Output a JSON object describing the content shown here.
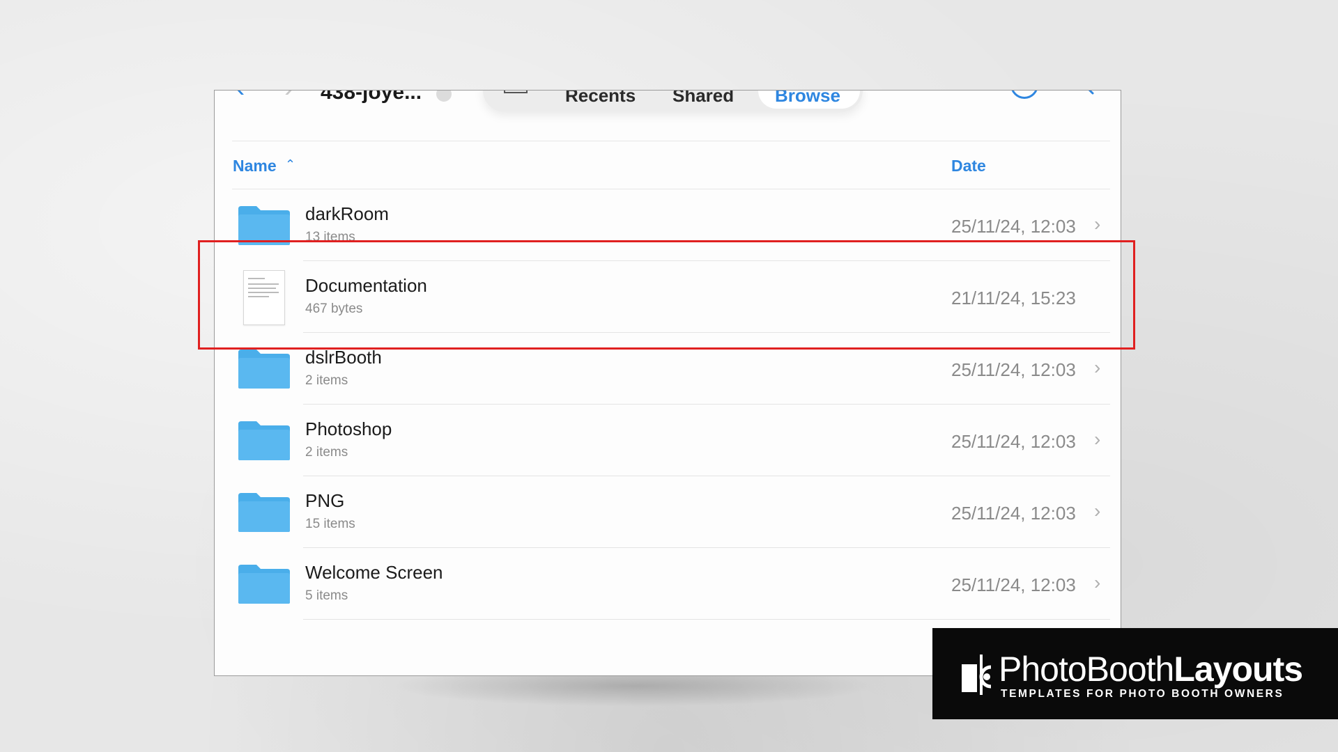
{
  "toolbar": {
    "folder_title": "438-joye...",
    "tabs": [
      "Recents",
      "Shared"
    ],
    "active_tab": "Browse"
  },
  "columns": {
    "name": "Name",
    "date": "Date"
  },
  "files": [
    {
      "name": "darkRoom",
      "detail": "13 items",
      "date": "25/11/24, 12:03",
      "type": "folder"
    },
    {
      "name": "Documentation",
      "detail": "467 bytes",
      "date": "21/11/24, 15:23",
      "type": "document"
    },
    {
      "name": "dslrBooth",
      "detail": "2 items",
      "date": "25/11/24, 12:03",
      "type": "folder"
    },
    {
      "name": "Photoshop",
      "detail": "2 items",
      "date": "25/11/24, 12:03",
      "type": "folder"
    },
    {
      "name": "PNG",
      "detail": "15 items",
      "date": "25/11/24, 12:03",
      "type": "folder"
    },
    {
      "name": "Welcome Screen",
      "detail": "5 items",
      "date": "25/11/24, 12:03",
      "type": "folder"
    }
  ],
  "logo": {
    "brand_light": "PhotoBooth",
    "brand_bold": "Layouts",
    "tagline": "TEMPLATES FOR PHOTO BOOTH OWNERS"
  },
  "colors": {
    "accent": "#2e86e0",
    "folder": "#5ab8f0",
    "highlight": "#e02020"
  }
}
